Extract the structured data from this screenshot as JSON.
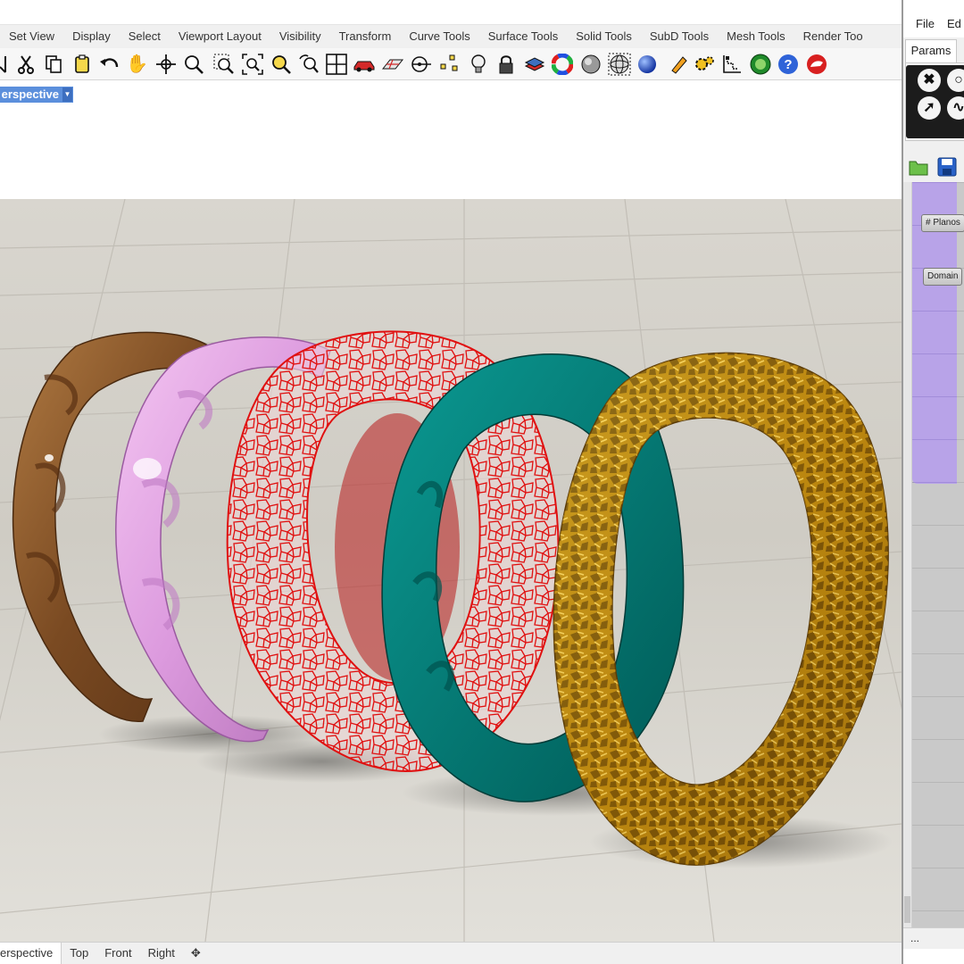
{
  "rhino": {
    "menu_tabs": [
      "Set View",
      "Display",
      "Select",
      "Viewport Layout",
      "Visibility",
      "Transform",
      "Curve Tools",
      "Surface Tools",
      "Solid Tools",
      "SubD Tools",
      "Mesh Tools",
      "Render Too"
    ],
    "toolbar_icons": [
      "select-icon",
      "cut-icon",
      "copy-icon",
      "paste-icon",
      "undo-icon",
      "pan-hand-icon",
      "rotate-view-icon",
      "zoom-icon",
      "zoom-window-icon",
      "zoom-extents-icon",
      "zoom-selected-icon",
      "undo-view-icon",
      "four-viewports-icon",
      "named-views-icon",
      "cplane-icon",
      "osnap-icon",
      "points-icon",
      "light-icon",
      "lock-icon",
      "layer-icon",
      "color-wheel-icon",
      "shaded-sphere-icon",
      "wireframe-sphere-icon",
      "render-sphere-icon",
      "pencil-icon",
      "gear-icon",
      "dimension-icon",
      "grasshopper-icon",
      "help-icon",
      "rhino-logo-icon"
    ],
    "viewport_label": "erspective",
    "viewport_tabs": [
      "erspective",
      "Top",
      "Front",
      "Right"
    ],
    "add_tab_glyph": "✥"
  },
  "grasshopper": {
    "menu": [
      "File",
      "Ed"
    ],
    "tab": "Params",
    "components": [
      "# Planos",
      "Domain"
    ],
    "status": "..."
  },
  "colors": {
    "viewport_label_bg": "#5b8fdc",
    "purple_group": "#b8a3e8",
    "wood_ring": "#8a5a2c",
    "pink_ring": "#e4a6e8",
    "red_wire_ring": "#e01010",
    "teal_ring": "#007f7a",
    "gold_ring": "#d4a017"
  }
}
